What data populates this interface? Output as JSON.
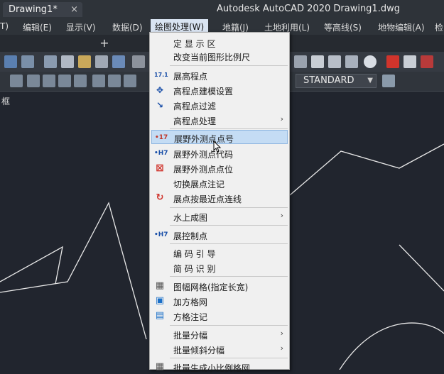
{
  "window": {
    "title": "Autodesk AutoCAD 2020    Drawing1.dwg"
  },
  "menubar": {
    "items": [
      {
        "label": "T)"
      },
      {
        "label": "编辑(E)"
      },
      {
        "label": "显示(V)"
      },
      {
        "label": "数据(D)"
      },
      {
        "label": "绘图处理(W)"
      },
      {
        "label": "地籍(J)"
      },
      {
        "label": "土地利用(L)"
      },
      {
        "label": "等高线(S)"
      },
      {
        "label": "地物编辑(A)"
      },
      {
        "label": "检"
      }
    ]
  },
  "tabs": {
    "doc": "Drawing1*",
    "close": "×",
    "add": "+"
  },
  "toolbar": {
    "textstyle": "STANDARD"
  },
  "canvas": {
    "label": "框"
  },
  "dropdown": {
    "items": [
      {
        "label": "定 显 示 区",
        "icon": "",
        "color": "",
        "submenu": false
      },
      {
        "label": "改变当前图形比例尺",
        "icon": "",
        "color": "",
        "submenu": false
      },
      {
        "label": "展高程点",
        "icon": "17.1",
        "color": "#1a4fa8",
        "submenu": false
      },
      {
        "label": "高程点建模设置",
        "icon": "✥",
        "color": "#1a4fa8",
        "submenu": false
      },
      {
        "label": "高程点过滤",
        "icon": "↘",
        "color": "#1a4fa8",
        "submenu": false
      },
      {
        "label": "高程点处理",
        "icon": "",
        "color": "",
        "submenu": true
      },
      {
        "label": "展野外测点点号",
        "icon": "•17",
        "color": "#c0392b",
        "submenu": false
      },
      {
        "label": "展野外测点代码",
        "icon": "•H7",
        "color": "#1a4fa8",
        "submenu": false
      },
      {
        "label": "展野外测点点位",
        "icon": "⊠",
        "color": "#d0342c",
        "submenu": false
      },
      {
        "label": "切换展点注记",
        "icon": "",
        "color": "",
        "submenu": false
      },
      {
        "label": "展点按最近点连线",
        "icon": "↻",
        "color": "#d0342c",
        "submenu": false
      },
      {
        "label": "水上成图",
        "icon": "",
        "color": "",
        "submenu": true
      },
      {
        "label": "展控制点",
        "icon": "•H7",
        "color": "#1a4fa8",
        "submenu": false
      },
      {
        "label": "编 码 引 导",
        "icon": "",
        "color": "",
        "submenu": false
      },
      {
        "label": "简 码 识 别",
        "icon": "",
        "color": "",
        "submenu": false
      },
      {
        "label": "图幅网格(指定长宽)",
        "icon": "▦",
        "color": "#555555",
        "submenu": false
      },
      {
        "label": "加方格网",
        "icon": "▣",
        "color": "#1a6fc8",
        "submenu": false
      },
      {
        "label": "方格注记",
        "icon": "▤",
        "color": "#1a6fc8",
        "submenu": false
      },
      {
        "label": "批量分幅",
        "icon": "",
        "color": "",
        "submenu": true
      },
      {
        "label": "批量倾斜分幅",
        "icon": "",
        "color": "",
        "submenu": true
      },
      {
        "label": "批量生成小比例格网",
        "icon": "▦",
        "color": "#555555",
        "submenu": false
      }
    ],
    "highlighted_index": 6,
    "submenu_arrow": "›"
  },
  "colors": {
    "canvas": "#21252e",
    "menu_bg": "#f0f0f0",
    "menu_highlight": "#c4dcf4",
    "active_menu": "#d9e4f2"
  }
}
